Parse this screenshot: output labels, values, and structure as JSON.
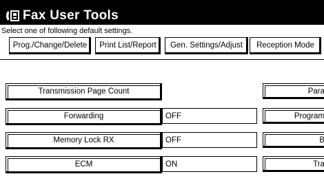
{
  "window": {
    "title": "Fax User Tools",
    "icon": "fax-phone-icon"
  },
  "instruction": "Select one of following default settings.",
  "tabs": [
    {
      "label": "Prog./Change/Delete"
    },
    {
      "label": "Print List/Report"
    },
    {
      "label": "Gen. Settings/Adjust",
      "selected": true
    },
    {
      "label": "Reception Mode"
    }
  ],
  "settings": [
    {
      "label": "Transmission Page Count",
      "value": null
    },
    {
      "label": "Forwarding",
      "value": "OFF"
    },
    {
      "label": "Memory Lock RX",
      "value": "OFF"
    },
    {
      "label": "ECM",
      "value": "ON"
    }
  ],
  "right_column": [
    {
      "label": "Para"
    },
    {
      "label": "Program"
    },
    {
      "label": "B"
    },
    {
      "label": "Tra"
    }
  ]
}
